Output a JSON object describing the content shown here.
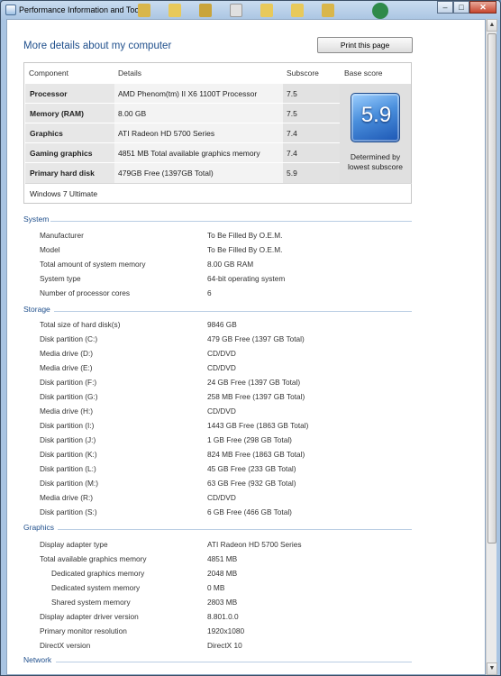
{
  "window": {
    "title": "Performance Information and Tools"
  },
  "header": {
    "heading": "More details about my computer",
    "print_label": "Print this page"
  },
  "score_table": {
    "columns": [
      "Component",
      "Details",
      "Subscore",
      "Base score"
    ],
    "rows": [
      {
        "component": "Processor",
        "details": "AMD Phenom(tm) II X6 1100T Processor",
        "subscore": "7.5"
      },
      {
        "component": "Memory (RAM)",
        "details": "8.00 GB",
        "subscore": "7.5"
      },
      {
        "component": "Graphics",
        "details": "ATI Radeon HD 5700 Series",
        "subscore": "7.4"
      },
      {
        "component": "Gaming graphics",
        "details": "4851 MB Total available graphics memory",
        "subscore": "7.4"
      },
      {
        "component": "Primary hard disk",
        "details": "479GB Free (1397GB Total)",
        "subscore": "5.9"
      }
    ],
    "base_score": "5.9",
    "base_note": "Determined by lowest subscore",
    "os": "Windows 7 Ultimate"
  },
  "sections": [
    {
      "title": "System",
      "rows": [
        {
          "label": "Manufacturer",
          "value": "To Be Filled By O.E.M."
        },
        {
          "label": "Model",
          "value": "To Be Filled By O.E.M."
        },
        {
          "label": "Total amount of system memory",
          "value": "8.00 GB RAM"
        },
        {
          "label": "System type",
          "value": "64-bit operating system"
        },
        {
          "label": "Number of processor cores",
          "value": "6"
        }
      ]
    },
    {
      "title": "Storage",
      "rows": [
        {
          "label": "Total size of hard disk(s)",
          "value": "9846 GB"
        },
        {
          "label": "Disk partition (C:)",
          "value": "479 GB Free (1397 GB Total)"
        },
        {
          "label": "Media drive (D:)",
          "value": "CD/DVD"
        },
        {
          "label": "Media drive (E:)",
          "value": "CD/DVD"
        },
        {
          "label": "Disk partition (F:)",
          "value": "24 GB Free (1397 GB Total)"
        },
        {
          "label": "Disk partition (G:)",
          "value": "258 MB Free (1397 GB Total)"
        },
        {
          "label": "Media drive (H:)",
          "value": "CD/DVD"
        },
        {
          "label": "Disk partition (I:)",
          "value": "1443 GB Free (1863 GB Total)"
        },
        {
          "label": "Disk partition (J:)",
          "value": "1 GB Free (298 GB Total)"
        },
        {
          "label": "Disk partition (K:)",
          "value": "824 MB Free (1863 GB Total)"
        },
        {
          "label": "Disk partition (L:)",
          "value": "45 GB Free (233 GB Total)"
        },
        {
          "label": "Disk partition (M:)",
          "value": "63 GB Free (932 GB Total)"
        },
        {
          "label": "Media drive (R:)",
          "value": "CD/DVD"
        },
        {
          "label": "Disk partition (S:)",
          "value": "6 GB Free (466 GB Total)"
        }
      ]
    },
    {
      "title": "Graphics",
      "rows": [
        {
          "label": "Display adapter type",
          "value": "ATI Radeon HD 5700 Series"
        },
        {
          "label": "Total available graphics memory",
          "value": "4851 MB"
        },
        {
          "label": "Dedicated graphics memory",
          "value": "2048 MB",
          "indent": true
        },
        {
          "label": "Dedicated system memory",
          "value": "0 MB",
          "indent": true
        },
        {
          "label": "Shared system memory",
          "value": "2803 MB",
          "indent": true
        },
        {
          "label": "Display adapter driver version",
          "value": "8.801.0.0"
        },
        {
          "label": "Primary monitor resolution",
          "value": "1920x1080"
        },
        {
          "label": "DirectX version",
          "value": "DirectX 10"
        }
      ]
    },
    {
      "title": "Network",
      "rows": []
    }
  ]
}
